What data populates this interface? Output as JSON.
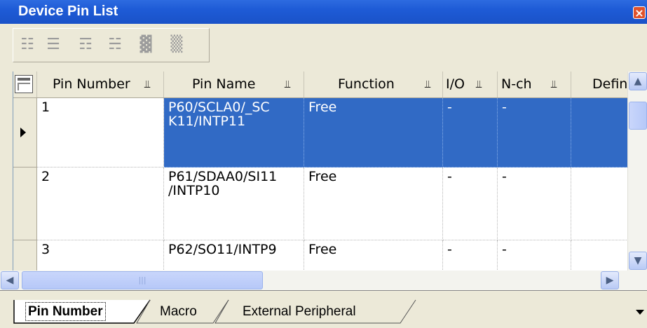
{
  "window": {
    "title": "Device Pin List",
    "close_icon": "close-icon"
  },
  "toolbar": {
    "buttons": [
      {
        "name": "toolbar-icon-1",
        "glyph": "☷"
      },
      {
        "name": "toolbar-icon-2",
        "glyph": "☰"
      },
      {
        "name": "toolbar-icon-3",
        "glyph": "☶"
      },
      {
        "name": "toolbar-icon-4",
        "glyph": "☵"
      },
      {
        "name": "toolbar-icon-5",
        "glyph": "▓"
      },
      {
        "name": "toolbar-icon-6",
        "glyph": "▒"
      }
    ]
  },
  "grid": {
    "columns": [
      "Pin Number",
      "Pin Name",
      "Function",
      "I/O",
      "N-ch",
      "Defin"
    ],
    "rows": [
      {
        "pin_number": "1",
        "pin_name": "P60/SCLA0/_SCK11/INTP11",
        "pin_name_l1": "P60/SCLA0/_SC",
        "pin_name_l2": "K11/INTP11",
        "function": "Free",
        "io": "-",
        "nch": "-",
        "defin": ""
      },
      {
        "pin_number": "2",
        "pin_name": "P61/SDAA0/SI11/INTP10",
        "pin_name_l1": "P61/SDAA0/SI11",
        "pin_name_l2": "/INTP10",
        "function": "Free",
        "io": "-",
        "nch": "-",
        "defin": ""
      },
      {
        "pin_number": "3",
        "pin_name": "P62/SO11/INTP9",
        "pin_name_l1": "P62/SO11/INTP9",
        "pin_name_l2": "",
        "function": "Free",
        "io": "-",
        "nch": "-",
        "defin": ""
      }
    ],
    "selected_row": 1,
    "pin_glyph": "⫫"
  },
  "tabs": [
    "Pin Number",
    "Macro",
    "External Peripheral"
  ],
  "active_tab": "Pin Number",
  "colors": {
    "titlebar": "#1e5bd6",
    "selection": "#316ac5",
    "panel": "#ece9d8"
  }
}
